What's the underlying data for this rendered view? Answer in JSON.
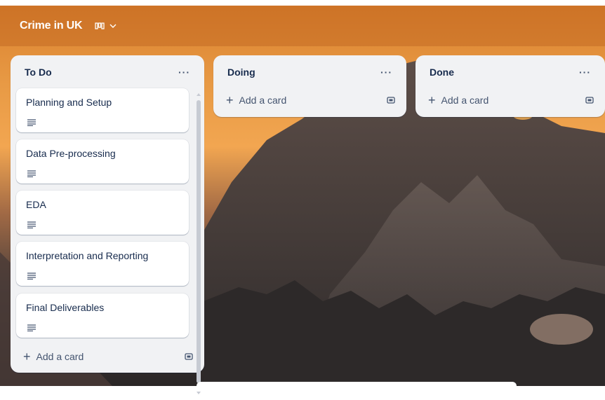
{
  "board": {
    "title": "Crime in UK"
  },
  "icons": {
    "view": "board-view-icon",
    "chevron": "chevron-down-icon",
    "more": "more-icon",
    "description": "description-icon",
    "template": "card-template-icon"
  },
  "lists": [
    {
      "title": "To Do",
      "more_label": "···",
      "cards": [
        {
          "title": "Planning and Setup"
        },
        {
          "title": "Data Pre-processing"
        },
        {
          "title": "EDA"
        },
        {
          "title": "Interpretation and Reporting"
        },
        {
          "title": "Final Deliverables"
        }
      ],
      "add_label": "Add a card"
    },
    {
      "title": "Doing",
      "more_label": "···",
      "cards": [],
      "add_label": "Add a card"
    },
    {
      "title": "Done",
      "more_label": "···",
      "cards": [],
      "add_label": "Add a card"
    }
  ],
  "colors": {
    "header_text": "#ffffff",
    "list_bg": "#f1f2f4",
    "card_bg": "#ffffff",
    "text": "#172b4d"
  }
}
